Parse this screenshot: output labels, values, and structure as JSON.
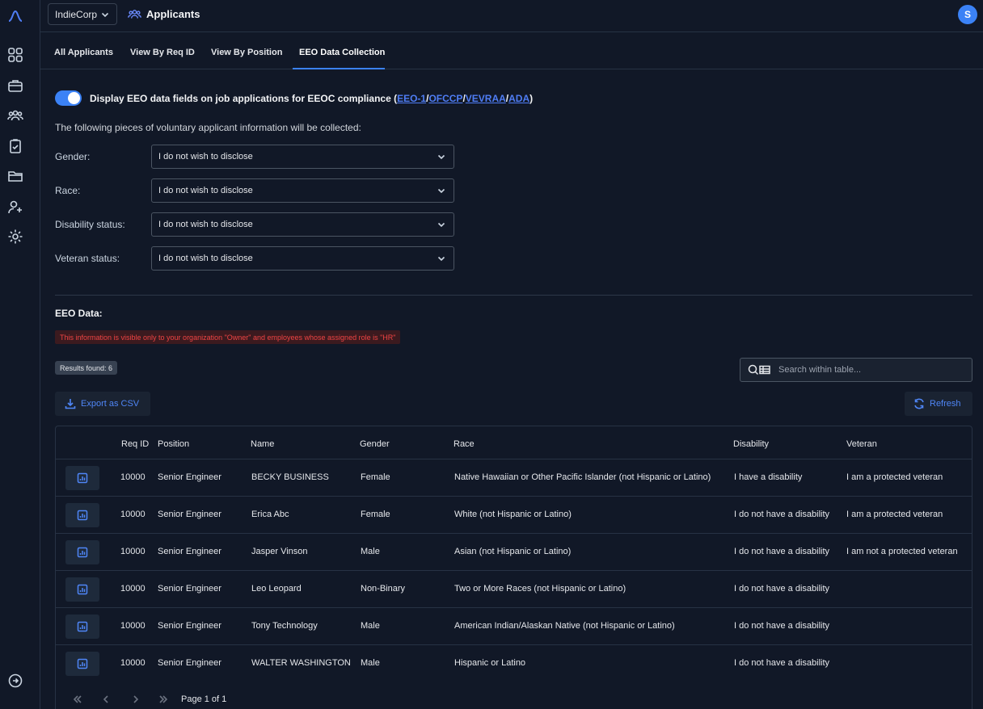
{
  "topbar": {
    "org": "IndieCorp",
    "page_title": "Applicants",
    "avatar_initial": "S"
  },
  "sidebar": {
    "icons": [
      "logo-icon",
      "dashboard-grid-icon",
      "briefcase-icon",
      "people-icon",
      "clipboard-check-icon",
      "folder-icon",
      "add-user-icon",
      "settings-gear-icon",
      "sign-out-icon"
    ]
  },
  "tabs": [
    {
      "label": "All Applicants"
    },
    {
      "label": "View By Req ID"
    },
    {
      "label": "View By Position"
    },
    {
      "label": "EEO Data Collection",
      "active": true
    }
  ],
  "eeo_toggle": {
    "enabled": true,
    "label_prefix": "Display EEO data fields on job applications for EEOC compliance (",
    "links": [
      "EEO-1",
      "OFCCP",
      "VEVRAA",
      "ADA"
    ],
    "separator": "/",
    "label_suffix": ")"
  },
  "intro": "The following pieces of voluntary applicant information will be collected:",
  "fields": [
    {
      "label": "Gender:",
      "value": "I do not wish to disclose"
    },
    {
      "label": "Race:",
      "value": "I do not wish to disclose"
    },
    {
      "label": "Disability status:",
      "value": "I do not wish to disclose"
    },
    {
      "label": "Veteran status:",
      "value": "I do not wish to disclose"
    }
  ],
  "eeo_data": {
    "title": "EEO Data:",
    "warning": "This information is visible only to your organization \"Owner\" and employees whose assigned role is \"HR\"",
    "results": "Results found: 6",
    "search_placeholder": "Search within table...",
    "export_label": "Export as CSV",
    "refresh_label": "Refresh"
  },
  "table": {
    "headers": [
      "Req ID",
      "Position",
      "Name",
      "Gender",
      "Race",
      "Disability",
      "Veteran"
    ],
    "rows": [
      [
        "10000",
        "Senior Engineer",
        "BECKY BUSINESS",
        "Female",
        "Native Hawaiian or Other Pacific Islander (not Hispanic or Latino)",
        "I have a disability",
        "I am a protected veteran"
      ],
      [
        "10000",
        "Senior Engineer",
        "Erica Abc",
        "Female",
        "White (not Hispanic or Latino)",
        "I do not have a disability",
        "I am a protected veteran"
      ],
      [
        "10000",
        "Senior Engineer",
        "Jasper Vinson",
        "Male",
        "Asian (not Hispanic or Latino)",
        "I do not have a disability",
        "I am not a protected veteran"
      ],
      [
        "10000",
        "Senior Engineer",
        "Leo Leopard",
        "Non-Binary",
        "Two or More Races (not Hispanic or Latino)",
        "I do not have a disability",
        ""
      ],
      [
        "10000",
        "Senior Engineer",
        "Tony Technology",
        "Male",
        "American Indian/Alaskan Native (not Hispanic or Latino)",
        "I do not have a disability",
        ""
      ],
      [
        "10000",
        "Senior Engineer",
        "WALTER WASHINGTON",
        "Male",
        "Hispanic or Latino",
        "I do not have a disability",
        ""
      ]
    ],
    "pagination": "Page 1 of 1"
  },
  "colors": {
    "accent": "#3b82f6",
    "background": "#111827",
    "warning": "#ef4444"
  }
}
